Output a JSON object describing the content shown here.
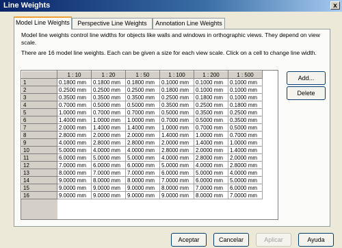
{
  "window": {
    "title": "Line Weights",
    "close_glyph": "x"
  },
  "tabs": [
    "Model Line Weights",
    "Perspective Line Weights",
    "Annotation Line Weights"
  ],
  "description": {
    "line1": "Model line weights control line widths for objects like walls and windows in orthographic views. They depend on view scale.",
    "line2": "There are 16 model line weights. Each can be given a size for each view scale. Click on a cell to change line width."
  },
  "grid": {
    "columns": [
      "1 : 10",
      "1 : 20",
      "1 : 50",
      "1 : 100",
      "1 : 200",
      "1 : 500"
    ],
    "rows": [
      {
        "id": "1",
        "values": [
          "0.1800 mm",
          "0.1800 mm",
          "0.1800 mm",
          "0.1000 mm",
          "0.1000 mm",
          "0.1000 mm"
        ]
      },
      {
        "id": "2",
        "values": [
          "0.2500 mm",
          "0.2500 mm",
          "0.2500 mm",
          "0.1800 mm",
          "0.1000 mm",
          "0.1000 mm"
        ]
      },
      {
        "id": "3",
        "values": [
          "0.3500 mm",
          "0.3500 mm",
          "0.3500 mm",
          "0.2500 mm",
          "0.1800 mm",
          "0.1000 mm"
        ]
      },
      {
        "id": "4",
        "values": [
          "0.7000 mm",
          "0.5000 mm",
          "0.5000 mm",
          "0.3500 mm",
          "0.2500 mm",
          "0.1800 mm"
        ]
      },
      {
        "id": "5",
        "values": [
          "1.0000 mm",
          "0.7000 mm",
          "0.7000 mm",
          "0.5000 mm",
          "0.3500 mm",
          "0.2500 mm"
        ]
      },
      {
        "id": "6",
        "values": [
          "1.4000 mm",
          "1.0000 mm",
          "1.0000 mm",
          "0.7000 mm",
          "0.5000 mm",
          "0.3500 mm"
        ]
      },
      {
        "id": "7",
        "values": [
          "2.0000 mm",
          "1.4000 mm",
          "1.4000 mm",
          "1.0000 mm",
          "0.7000 mm",
          "0.5000 mm"
        ]
      },
      {
        "id": "8",
        "values": [
          "2.8000 mm",
          "2.0000 mm",
          "2.0000 mm",
          "1.4000 mm",
          "1.0000 mm",
          "0.7000 mm"
        ]
      },
      {
        "id": "9",
        "values": [
          "4.0000 mm",
          "2.8000 mm",
          "2.8000 mm",
          "2.0000 mm",
          "1.4000 mm",
          "1.0000 mm"
        ]
      },
      {
        "id": "10",
        "values": [
          "5.0000 mm",
          "4.0000 mm",
          "4.0000 mm",
          "2.8000 mm",
          "2.0000 mm",
          "1.4000 mm"
        ]
      },
      {
        "id": "11",
        "values": [
          "6.0000 mm",
          "5.0000 mm",
          "5.0000 mm",
          "4.0000 mm",
          "2.8000 mm",
          "2.0000 mm"
        ]
      },
      {
        "id": "12",
        "values": [
          "7.0000 mm",
          "6.0000 mm",
          "6.0000 mm",
          "5.0000 mm",
          "4.0000 mm",
          "2.8000 mm"
        ]
      },
      {
        "id": "13",
        "values": [
          "8.0000 mm",
          "7.0000 mm",
          "7.0000 mm",
          "6.0000 mm",
          "5.0000 mm",
          "4.0000 mm"
        ]
      },
      {
        "id": "14",
        "values": [
          "9.0000 mm",
          "8.0000 mm",
          "8.0000 mm",
          "7.0000 mm",
          "6.0000 mm",
          "5.0000 mm"
        ]
      },
      {
        "id": "15",
        "values": [
          "9.0000 mm",
          "9.0000 mm",
          "9.0000 mm",
          "8.0000 mm",
          "7.0000 mm",
          "6.0000 mm"
        ]
      },
      {
        "id": "16",
        "values": [
          "9.0000 mm",
          "9.0000 mm",
          "9.0000 mm",
          "9.0000 mm",
          "8.0000 mm",
          "7.0000 mm"
        ]
      }
    ]
  },
  "side_buttons": {
    "add": "Add...",
    "delete": "Delete"
  },
  "footer": {
    "ok": "Aceptar",
    "cancel": "Cancelar",
    "apply": "Aplicar",
    "help": "Ayuda"
  }
}
